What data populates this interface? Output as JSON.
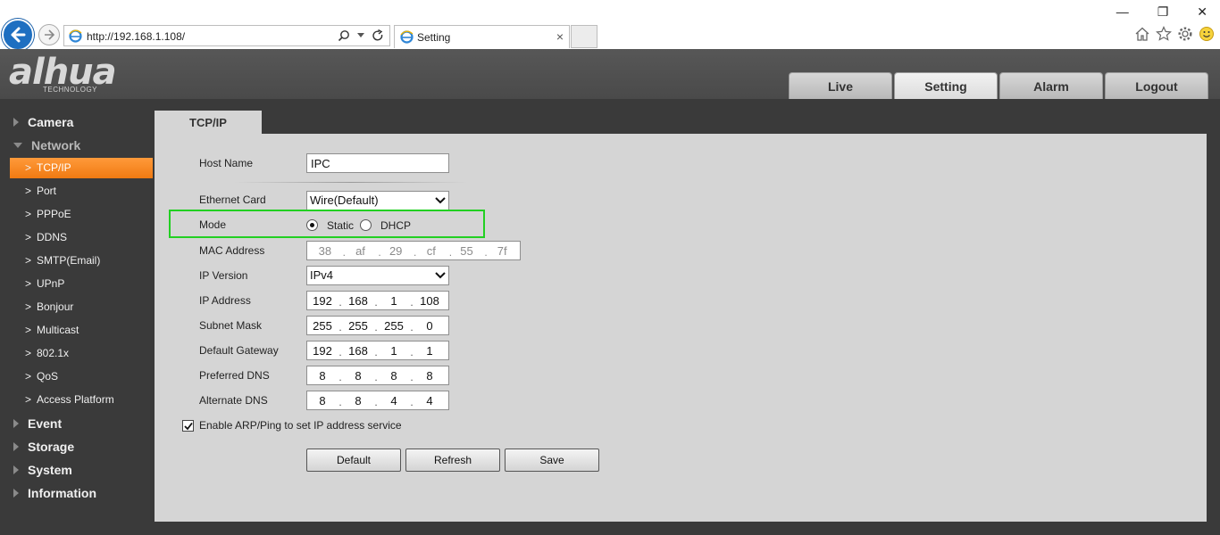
{
  "browser": {
    "url": "http://192.168.1.108/",
    "tab_title": "Setting",
    "tab_close": "×",
    "window_controls": {
      "minimize": "—",
      "restore": "❐",
      "close": "✕"
    }
  },
  "header": {
    "logo_text": "alhua",
    "logo_sub": "TECHNOLOGY",
    "nav": [
      {
        "label": "Live"
      },
      {
        "label": "Setting"
      },
      {
        "label": "Alarm"
      },
      {
        "label": "Logout"
      }
    ]
  },
  "sidebar": {
    "sections": {
      "camera": "Camera",
      "network": "Network",
      "event": "Event",
      "storage": "Storage",
      "system": "System",
      "information": "Information"
    },
    "network_items": [
      {
        "label": "TCP/IP"
      },
      {
        "label": "Port"
      },
      {
        "label": "PPPoE"
      },
      {
        "label": "DDNS"
      },
      {
        "label": "SMTP(Email)"
      },
      {
        "label": "UPnP"
      },
      {
        "label": "Bonjour"
      },
      {
        "label": "Multicast"
      },
      {
        "label": "802.1x"
      },
      {
        "label": "QoS"
      },
      {
        "label": "Access Platform"
      }
    ]
  },
  "main": {
    "tab_label": "TCP/IP",
    "host_name": {
      "label": "Host Name",
      "value": "IPC"
    },
    "ethernet_card": {
      "label": "Ethernet Card",
      "value": "Wire(Default)"
    },
    "mode": {
      "label": "Mode",
      "static": "Static",
      "dhcp": "DHCP",
      "selected": "Static"
    },
    "mac_address": {
      "label": "MAC Address",
      "octets": [
        "38",
        "af",
        "29",
        "cf",
        "55",
        "7f"
      ]
    },
    "ip_version": {
      "label": "IP Version",
      "value": "IPv4"
    },
    "ip_address": {
      "label": "IP Address",
      "octets": [
        "192",
        "168",
        "1",
        "108"
      ]
    },
    "subnet_mask": {
      "label": "Subnet Mask",
      "octets": [
        "255",
        "255",
        "255",
        "0"
      ]
    },
    "default_gateway": {
      "label": "Default Gateway",
      "octets": [
        "192",
        "168",
        "1",
        "1"
      ]
    },
    "preferred_dns": {
      "label": "Preferred DNS",
      "octets": [
        "8",
        "8",
        "8",
        "8"
      ]
    },
    "alternate_dns": {
      "label": "Alternate DNS",
      "octets": [
        "8",
        "8",
        "4",
        "4"
      ]
    },
    "arp_ping": {
      "label": "Enable ARP/Ping to set IP address service",
      "checked": true
    },
    "buttons": {
      "default": "Default",
      "refresh": "Refresh",
      "save": "Save"
    }
  },
  "colors": {
    "active_menu": "#f07a12",
    "highlight_box": "#22d022",
    "panel_bg": "#d5d5d5",
    "app_bg": "#3a3a3a"
  }
}
